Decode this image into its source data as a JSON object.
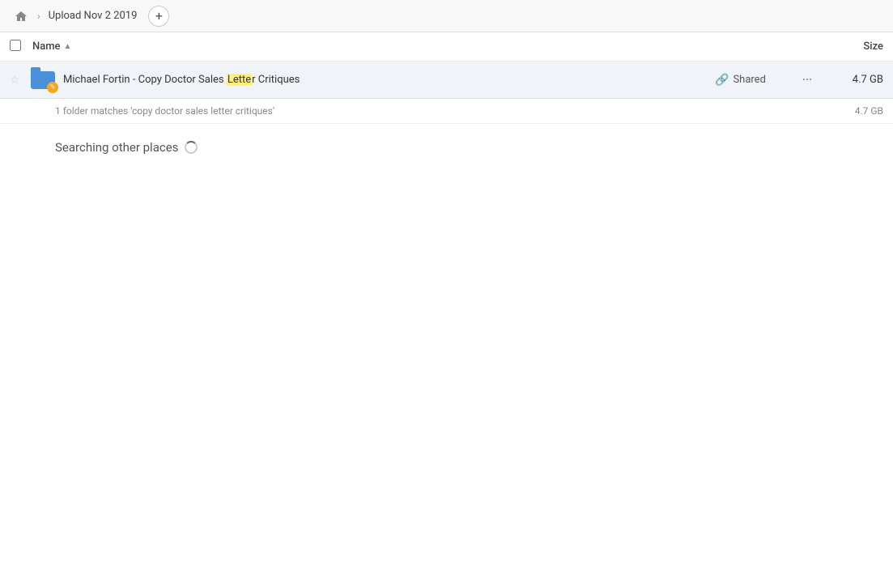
{
  "header": {
    "home_icon": "🏠",
    "breadcrumb_separator": "›",
    "breadcrumb_label": "Upload Nov 2 2019",
    "add_button_label": "+"
  },
  "columns": {
    "name_label": "Name",
    "sort_icon": "▲",
    "size_label": "Size"
  },
  "file_row": {
    "folder_name_full": "Michael Fortin - Copy Doctor Sales Letter Critiques",
    "folder_name_before_highlight": "Michael Fortin - Copy Doctor Sales ",
    "folder_name_highlight": "Lette",
    "folder_name_after_highlight": "r Critiques",
    "shared_label": "Shared",
    "file_size": "4.7 GB",
    "star_icon": "☆",
    "more_icon": "···"
  },
  "match_count": {
    "text": "1 folder matches 'copy doctor sales letter critiques'",
    "size": "4.7 GB"
  },
  "searching": {
    "label": "Searching other places"
  },
  "colors": {
    "folder_blue": "#4a90d9",
    "folder_overlay_yellow": "#f5a623",
    "row_bg": "#f0f4f9"
  }
}
